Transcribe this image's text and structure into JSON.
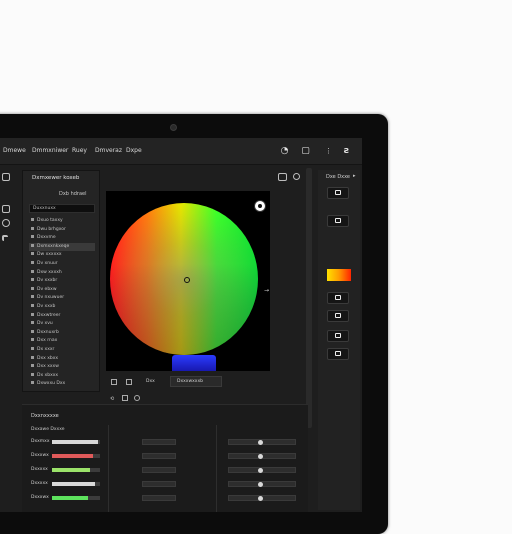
{
  "menu": {
    "items": [
      "Dmewe",
      "Dmmxniwer",
      "Ruey",
      "Dmveraz",
      "Dxpe"
    ]
  },
  "layers_panel": {
    "title": "Dxmxewer koxeb",
    "subtitle": "Dxb hdrael",
    "search_value": "Duxxnuxx",
    "layers": [
      "Dxuo taxxy",
      "Dwu brhgxor",
      "Dxxvme",
      "Dxmxxnkxeqe",
      "Dw xxxxxx",
      "Dv xnuur",
      "Dxw xxxxh",
      "Dv xxxbr",
      "Dv ebxw",
      "Dv nxuwuer",
      "Dv xxxb",
      "Dxxwtreer",
      "Dv xvu",
      "Dxxnuxrb",
      "Dxx rnax",
      "Dx xxxr",
      "Dxx xbxx",
      "Dxx xxxw",
      "Dx xbxxx",
      "Dxwxxu Dxx"
    ],
    "selected_index": 3
  },
  "canvas": {
    "footer_label": "Dxx",
    "footer_field": "Dxxxwxxxb"
  },
  "right_panel": {
    "title": "Dxe Dxxe",
    "swatch_colors": [
      "#ffe100",
      "#ff9a00",
      "#ff2400"
    ]
  },
  "properties": {
    "title": "Dxxnxxxxe",
    "subtitle": "Dxxawe Dxxxe",
    "rows": [
      {
        "label": "Dxxmxx",
        "level": 0.95,
        "color": "#d8d8d8"
      },
      {
        "label": "Dxxxwx",
        "level": 0.85,
        "color": "#e05a5a"
      },
      {
        "label": "Dxxxxx",
        "level": 0.8,
        "color": "#9be36a"
      },
      {
        "label": "Dxxxxx",
        "level": 0.9,
        "color": "#d9d9d9"
      },
      {
        "label": "Dxxxwx",
        "level": 0.75,
        "color": "#5ee35e"
      }
    ]
  },
  "colors": {
    "accent": "#3cff2a",
    "panel_bg": "#242424",
    "screen_bg": "#1e1e1e"
  }
}
